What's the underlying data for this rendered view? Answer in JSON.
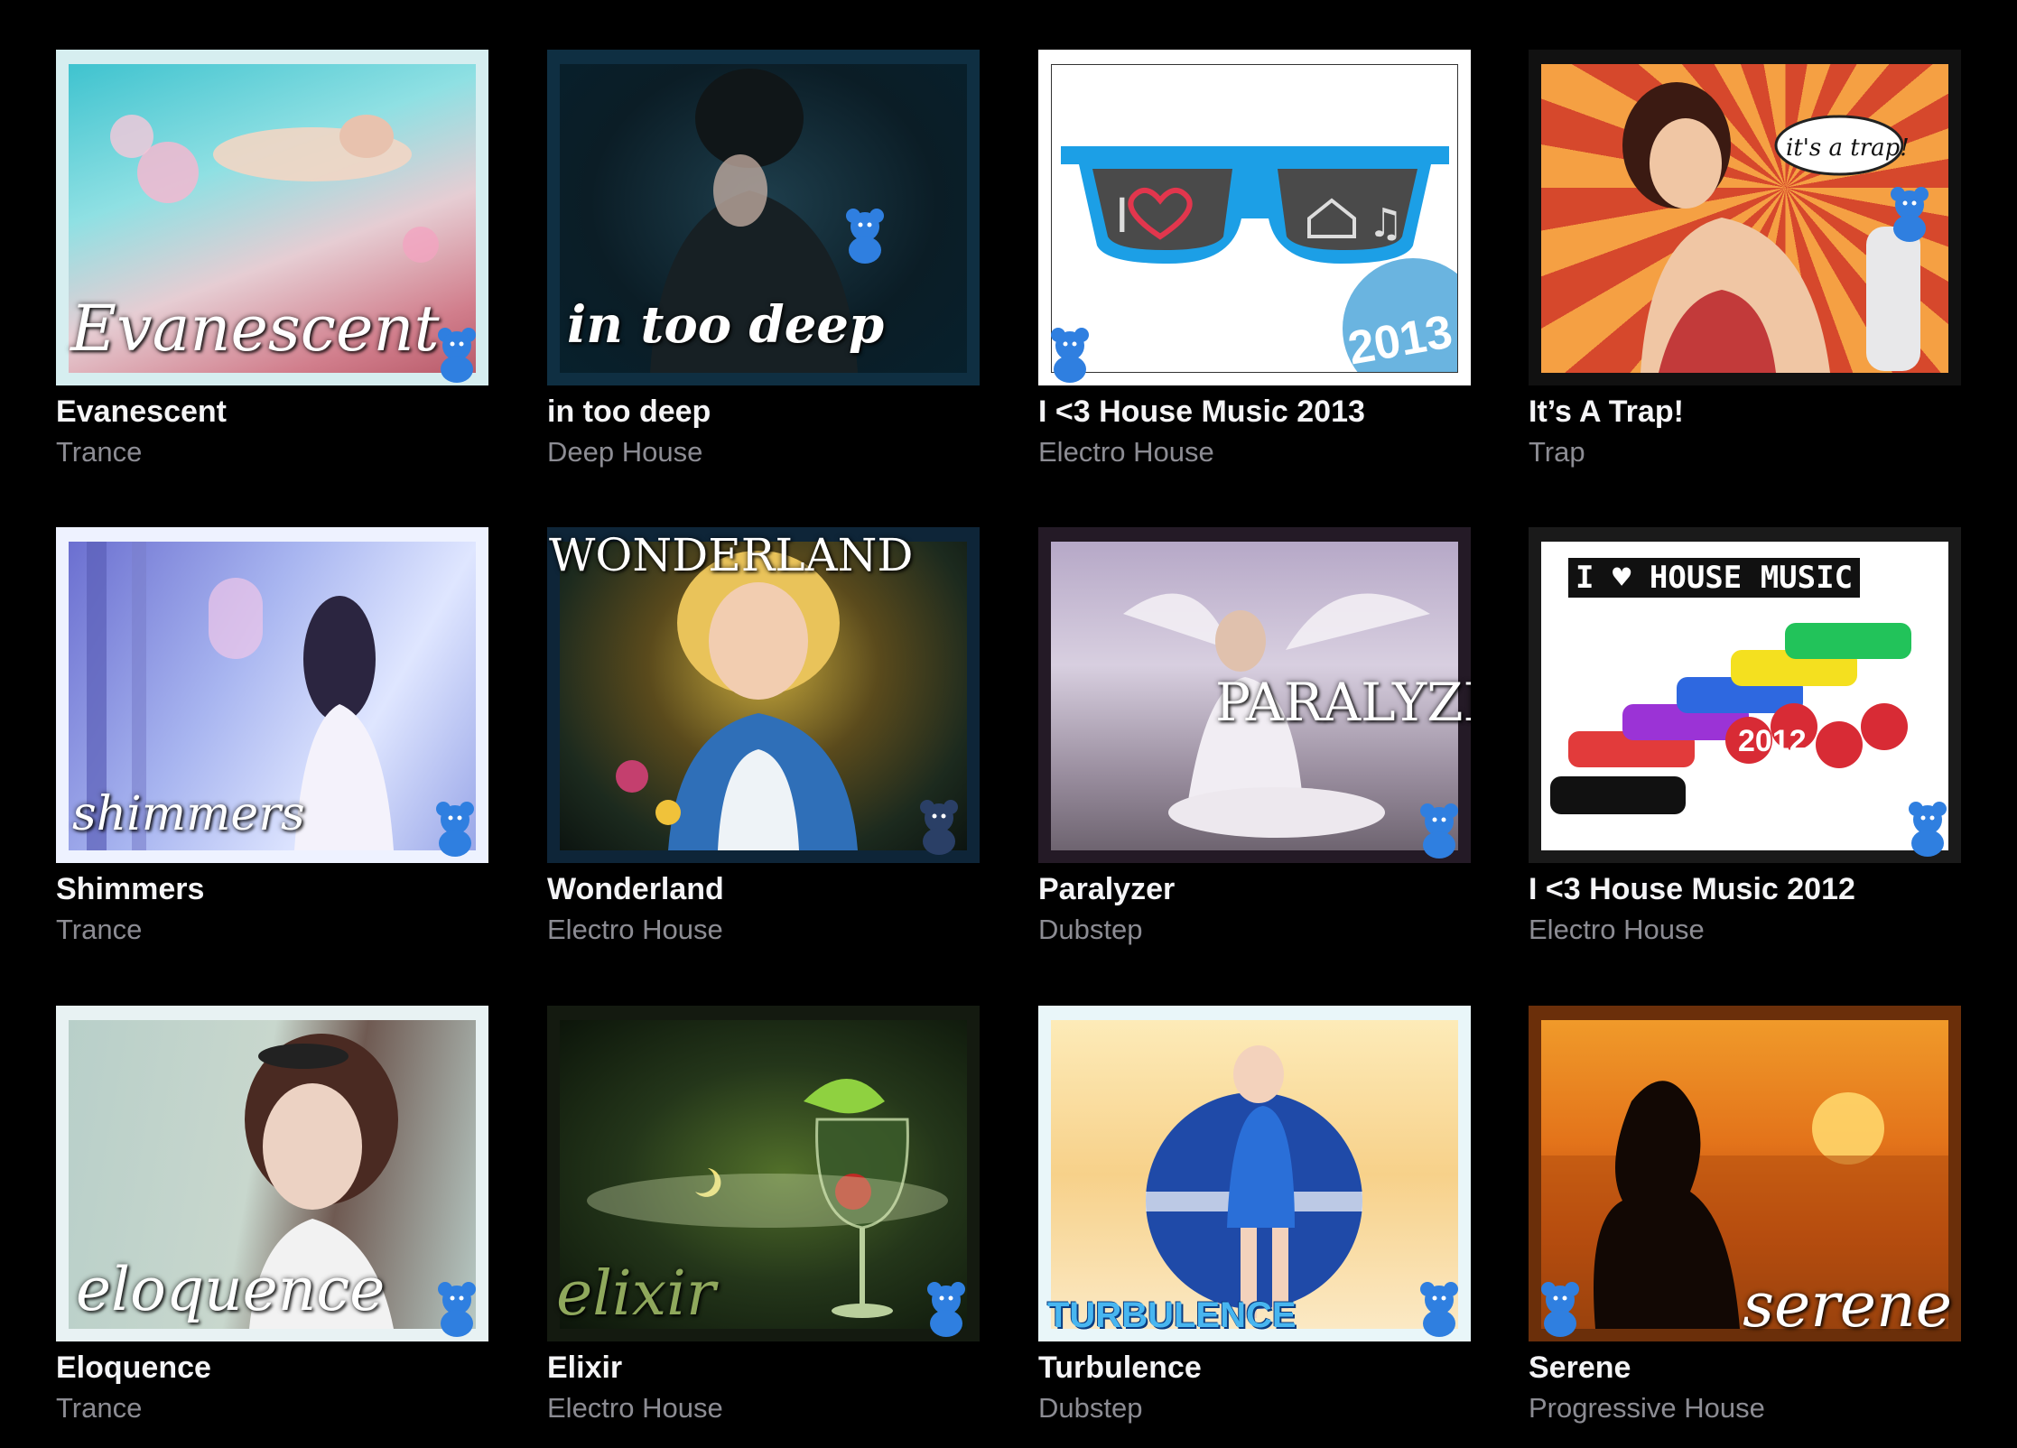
{
  "albums": [
    {
      "title": "Evanescent",
      "genre": "Trance",
      "art_text": "Evanescent"
    },
    {
      "title": "in too deep",
      "genre": "Deep House",
      "art_text": "in too deep"
    },
    {
      "title": "I <3 House Music 2013",
      "genre": "Electro House",
      "art_text": "2013"
    },
    {
      "title": "It’s A Trap!",
      "genre": "Trap",
      "art_text": "it's a trap!"
    },
    {
      "title": "Shimmers",
      "genre": "Trance",
      "art_text": "shimmers"
    },
    {
      "title": "Wonderland",
      "genre": "Electro House",
      "art_text": "WONDERLAND"
    },
    {
      "title": "Paralyzer",
      "genre": "Dubstep",
      "art_text": "PARALYZER"
    },
    {
      "title": "I <3 House Music 2012",
      "genre": "Electro House",
      "art_text": "I ♥ HOUSE MUSIC"
    },
    {
      "title": "Eloquence",
      "genre": "Trance",
      "art_text": "eloquence"
    },
    {
      "title": "Elixir",
      "genre": "Electro House",
      "art_text": "elixir"
    },
    {
      "title": "Turbulence",
      "genre": "Dubstep",
      "art_text": "TURBULENCE"
    },
    {
      "title": "Serene",
      "genre": "Progressive House",
      "art_text": "serene"
    }
  ],
  "art_extras": {
    "h13_year_art": "2012"
  },
  "colors": {
    "background": "#000000",
    "title": "#f4f4f6",
    "genre": "#8c8c93",
    "bear": "#2f7fe0"
  },
  "icons": {
    "mascot": "blue-teddy-bear-icon",
    "heart": "heart-icon",
    "house": "house-icon",
    "music_note": "music-note-icon"
  }
}
